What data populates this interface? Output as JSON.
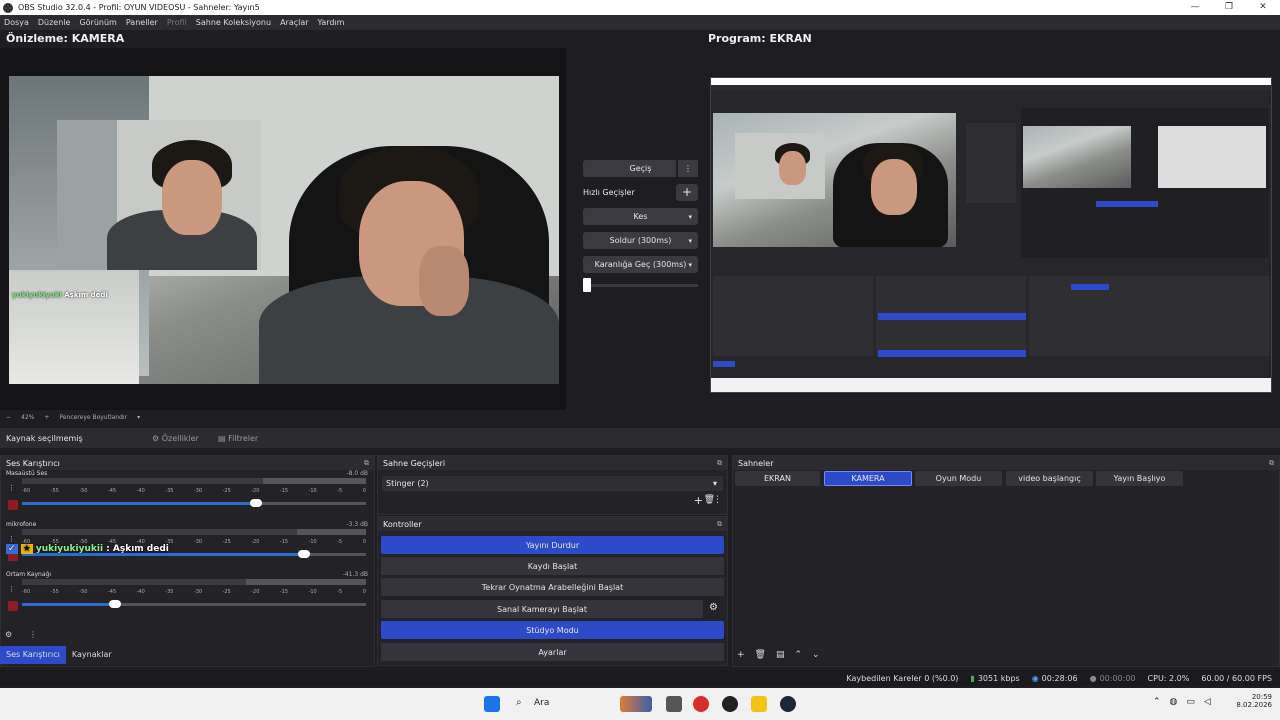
{
  "window": {
    "title": "OBS Studio 32.0.4 - Profil: OYUN VIDEOSU - Sahneler: Yayın5",
    "min": "—",
    "max": "❐",
    "close": "✕"
  },
  "menu": [
    "Dosya",
    "Düzenle",
    "Görünüm",
    "Paneller",
    "Profil",
    "Sahne Koleksiyonu",
    "Araçlar",
    "Yardım"
  ],
  "preview": {
    "title": "Önizleme: KAMERA",
    "zoom_minus": "−",
    "zoom": "42%",
    "zoom_plus": "+",
    "fit": "Pencereye Boyutlandır",
    "chat_name": "yukiyukiyuki",
    "chat_msg": "Aşkım dedi"
  },
  "program": {
    "title": "Program: EKRAN"
  },
  "transition": {
    "label": "Geçiş",
    "dots": "⋮",
    "quick": "Hızlı Geçişler",
    "plus": "+",
    "items": [
      "Kes",
      "Soldur (300ms)",
      "Karanlığa Geç (300ms)"
    ]
  },
  "source_bar": {
    "none": "Kaynak seçilmemiş",
    "props": "Özellikler",
    "filters": "Filtreler"
  },
  "mixer": {
    "title": "Ses Karıştırıcı",
    "ticks": [
      "-60",
      "-55",
      "-50",
      "-45",
      "-40",
      "-35",
      "-30",
      "-25",
      "-20",
      "-15",
      "-10",
      "-5",
      "0"
    ],
    "channels": [
      {
        "name": "Masaüstü Ses",
        "db": "-8.0 dB",
        "level": 0.3,
        "volume": 0.68
      },
      {
        "name": "mikrofone",
        "db": "-3.3 dB",
        "level": 0.2,
        "volume": 0.82
      },
      {
        "name": "Ortam Kaynağı",
        "db": "-41.3 dB",
        "level": 0.35,
        "volume": 0.27
      }
    ],
    "overlay_name": "yukiyukiyukii",
    "overlay_msg": ": Aşkım dedi"
  },
  "bottom_tabs": [
    "Ses Karıştırıcı",
    "Kaynaklar"
  ],
  "scene_transitions": {
    "title": "Sahne Geçişleri",
    "value": "Stinger (2)"
  },
  "controls": {
    "title": "Kontroller",
    "buttons": [
      "Yayını Durdur",
      "Kaydı Başlat",
      "Tekrar Oynatma Arabelleğini Başlat",
      "Sanal Kamerayı Başlat",
      "Stüdyo Modu",
      "Ayarlar"
    ]
  },
  "scenes": {
    "title": "Sahneler",
    "items": [
      "EKRAN",
      "KAMERA",
      "Oyun Modu",
      "video başlangıç",
      "Yayın Başlıyo"
    ],
    "active": "KAMERA"
  },
  "status": {
    "dropped": "Kaybedilen Kareler 0 (%0.0)",
    "bitrate": "3051 kbps",
    "stream_time": "00:28:06",
    "rec_time": "00:00:00",
    "cpu": "CPU: 2.0%",
    "fps": "60.00 / 60.00 FPS"
  },
  "taskbar": {
    "search": "Ara",
    "time": "20:59",
    "date": "8.02.2026"
  },
  "colors": {
    "accent": "#2d4bc8",
    "mute": "#8e1c26"
  }
}
